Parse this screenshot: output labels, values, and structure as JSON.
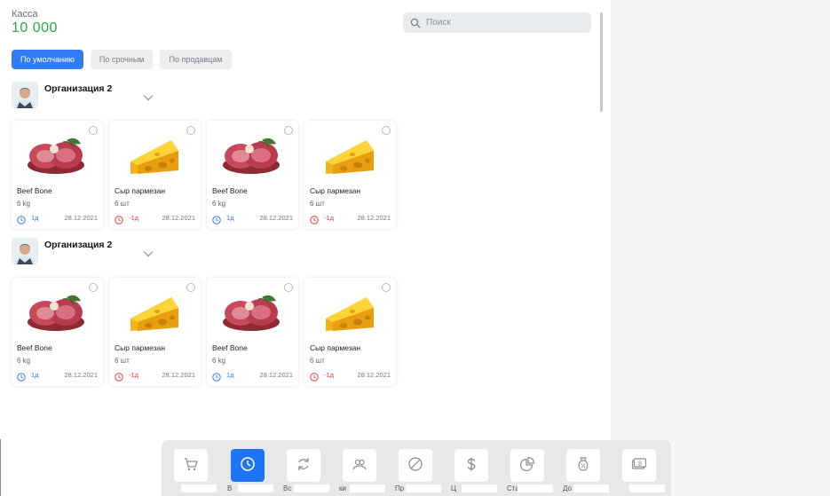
{
  "header": {
    "cash_label": "Касса",
    "cash_value": "10 000"
  },
  "search": {
    "placeholder": "Поиск"
  },
  "filters": [
    {
      "label": "По умолчанию",
      "active": true
    },
    {
      "label": "По срочным",
      "active": false
    },
    {
      "label": "По продавцам",
      "active": false
    }
  ],
  "groups": [
    {
      "org_name": "Организация 2",
      "products": [
        {
          "name": "Beef Bone",
          "qty": "6 kg",
          "days": "1д",
          "date": "28.12.2021",
          "kind": "meat",
          "urgent": false
        },
        {
          "name": "Сыр пармезан",
          "qty": "6 шт",
          "days": "-1д",
          "date": "28.12.2021",
          "kind": "cheese",
          "urgent": true
        },
        {
          "name": "Beef Bone",
          "qty": "6 kg",
          "days": "1д",
          "date": "28.12.2021",
          "kind": "meat",
          "urgent": false
        },
        {
          "name": "Сыр пармезан",
          "qty": "6 шт",
          "days": "-1д",
          "date": "28.12.2021",
          "kind": "cheese",
          "urgent": true
        }
      ]
    },
    {
      "org_name": "Организация 2",
      "products": [
        {
          "name": "Beef Bone",
          "qty": "6 kg",
          "days": "1д",
          "date": "28.12.2021",
          "kind": "meat",
          "urgent": false
        },
        {
          "name": "Сыр пармезан",
          "qty": "6 шт",
          "days": "-1д",
          "date": "28.12.2021",
          "kind": "cheese",
          "urgent": true
        },
        {
          "name": "Beef Bone",
          "qty": "6 kg",
          "days": "1д",
          "date": "28.12.2021",
          "kind": "meat",
          "urgent": false
        },
        {
          "name": "Сыр пармезан",
          "qty": "6 шт",
          "days": "-1д",
          "date": "28.12.2021",
          "kind": "cheese",
          "urgent": true
        }
      ]
    }
  ],
  "bottom_nav": [
    {
      "icon": "cart-icon",
      "label": "",
      "active": false
    },
    {
      "icon": "clock-icon",
      "label": "В",
      "active": true
    },
    {
      "icon": "refresh-icon",
      "label": "Вс",
      "active": false
    },
    {
      "icon": "users-icon",
      "label": "ки",
      "active": false
    },
    {
      "icon": "block-icon",
      "label": "Пр",
      "active": false
    },
    {
      "icon": "dollar-icon",
      "label": "Ц",
      "active": false
    },
    {
      "icon": "pie-chart-icon",
      "label": "Ста",
      "active": false
    },
    {
      "icon": "percent-bag-icon",
      "label": "До",
      "active": false
    },
    {
      "icon": "cash-icon",
      "label": "",
      "active": false
    }
  ],
  "colors": {
    "accent": "#2f7cf6",
    "cash": "#2aa84a",
    "ok": "#2f7cf6",
    "overdue": "#e23b3b"
  }
}
